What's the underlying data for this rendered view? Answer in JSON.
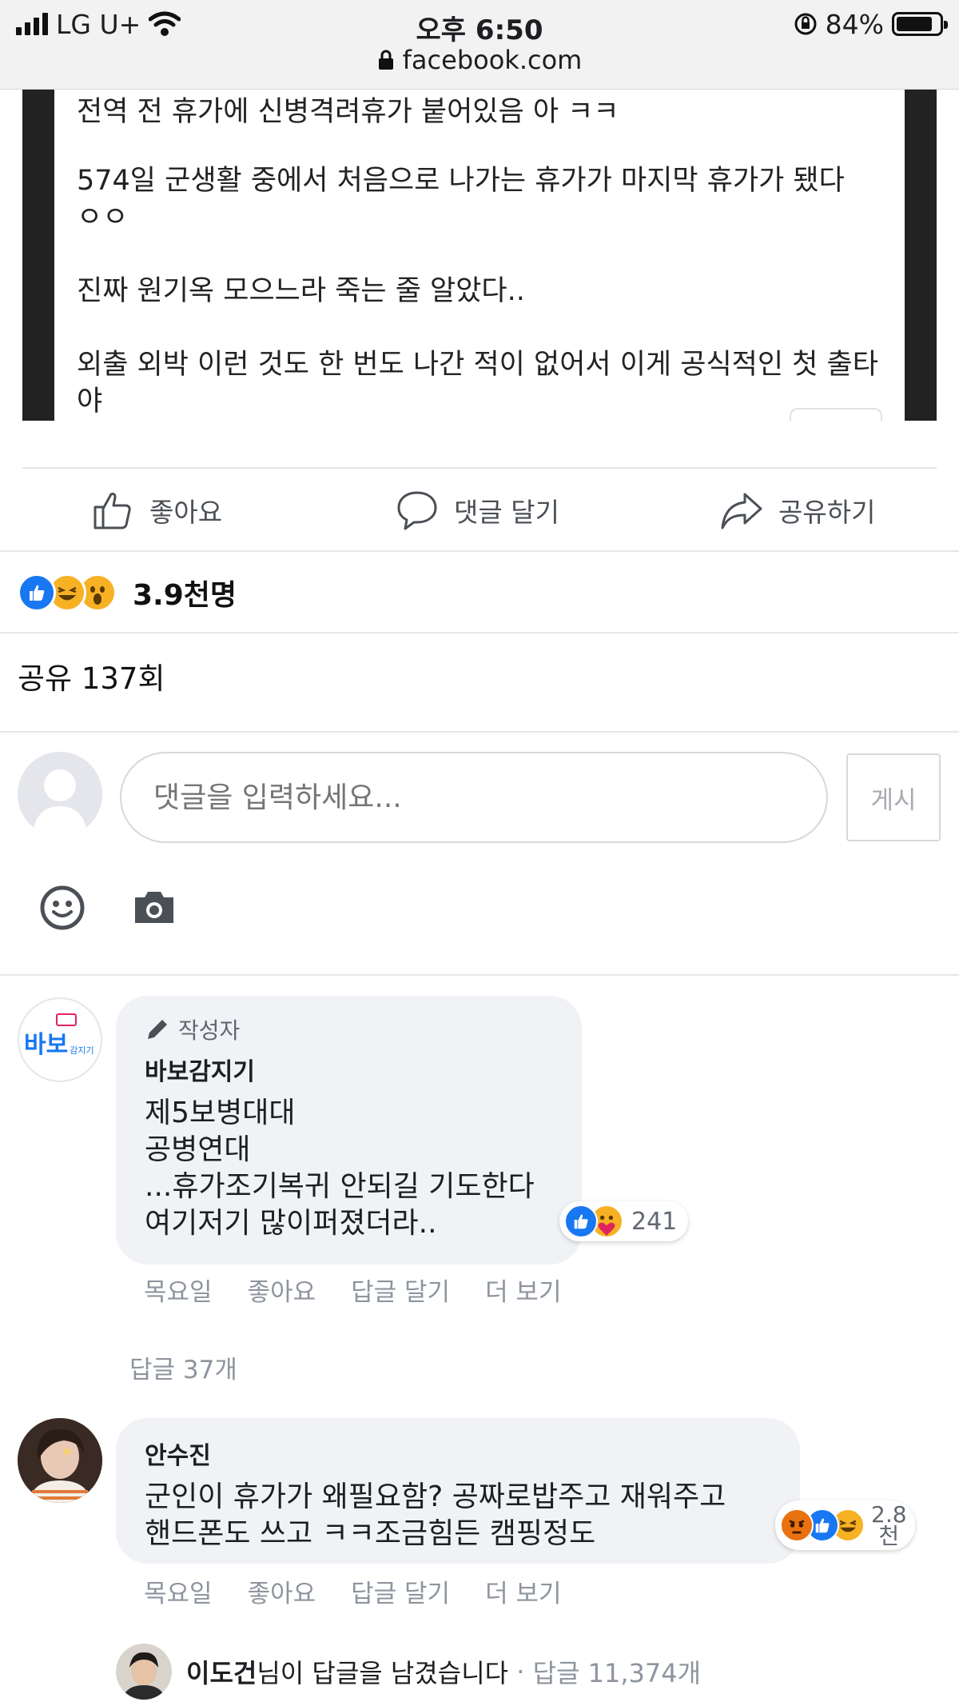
{
  "status_bar": {
    "carrier": "LG U+",
    "time": "오후 6:50",
    "battery": "84%",
    "battery_level": 0.84,
    "url": "facebook.com"
  },
  "post": {
    "paragraphs": [
      "전역 전 휴가에 신병격려휴가 붙어있음 아 ㅋㅋ",
      "574일 군생활 중에서 처음으로 나가는 휴가가 마지막 휴가가 됐다 ㅇㅇ",
      "진짜 원기옥 모으느라 죽는 줄 알았다..",
      "외출 외박 이런 것도 한 번도 나간 적이 없어서 이게 공식적인 첫 출타야"
    ]
  },
  "actions": {
    "like": "좋아요",
    "comment": "댓글 달기",
    "share": "공유하기"
  },
  "reactions": {
    "icons": [
      "like-icon",
      "haha-icon",
      "wow-icon"
    ],
    "count": "3.9천명"
  },
  "share_count": "공유 137회",
  "composer": {
    "placeholder": "댓글을 입력하세요...",
    "post_button": "게시"
  },
  "comments": [
    {
      "badge": "작성자",
      "avatar_text": "바보",
      "avatar_small_text": "감지기",
      "name": "바보감지기",
      "text": "제5보병대대\n공병연대\n...휴가조기복귀 안되길 기도한다\n여기저기 많이퍼졌더라..",
      "reaction_icons": [
        "like-icon",
        "care-icon"
      ],
      "reaction_count": "241",
      "meta": [
        "목요일",
        "좋아요",
        "답글 달기",
        "더 보기"
      ]
    },
    {
      "name": "안수진",
      "text": "군인이 휴가가 왜필요함? 공짜로밥주고 재워주고\n핸드폰도 쓰고 ㅋㅋ조금힘든 캠핑정도",
      "reaction_icons": [
        "angry-icon",
        "like-icon",
        "haha-icon"
      ],
      "reaction_count_top": "2.8",
      "reaction_count_bottom": "천",
      "meta": [
        "목요일",
        "좋아요",
        "답글 달기",
        "더 보기"
      ]
    }
  ],
  "replies_link": "답글 37개",
  "reply_summary": {
    "name": "이도건",
    "text": "님이 답글을 남겼습니다",
    "separator": " · ",
    "count": "답글 11,374개"
  },
  "colors": {
    "like_blue": "#1877f2",
    "reaction_yellow": "#f7b125",
    "angry_orange": "#e9710f",
    "meta_gray": "#8d949e"
  }
}
